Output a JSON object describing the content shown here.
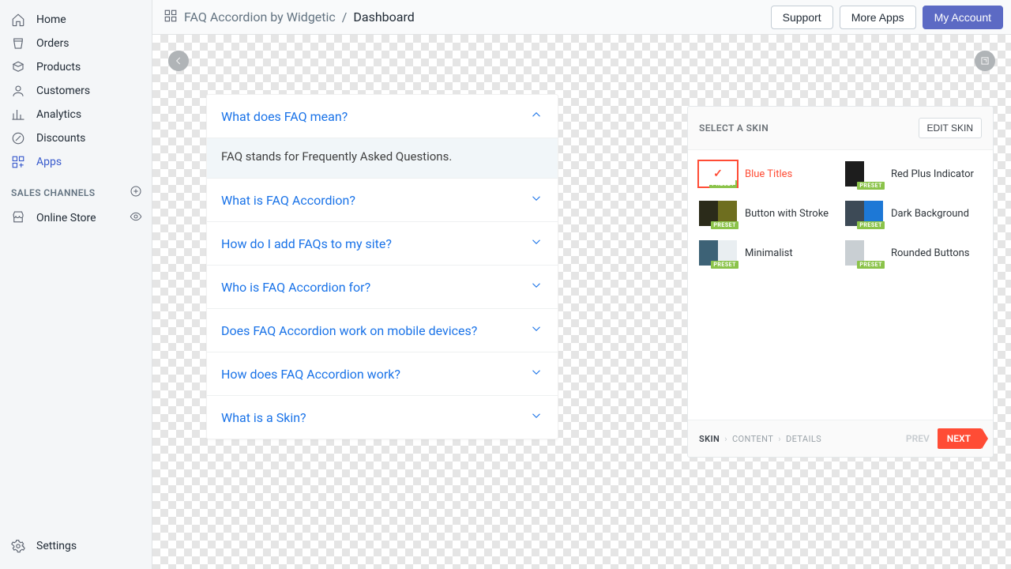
{
  "sidebar": {
    "items": [
      {
        "label": "Home"
      },
      {
        "label": "Orders"
      },
      {
        "label": "Products"
      },
      {
        "label": "Customers"
      },
      {
        "label": "Analytics"
      },
      {
        "label": "Discounts"
      },
      {
        "label": "Apps"
      }
    ],
    "section_label": "SALES CHANNELS",
    "channel_label": "Online Store",
    "settings_label": "Settings"
  },
  "topbar": {
    "app_name": "FAQ Accordion by Widgetic",
    "breadcrumb_current": "Dashboard",
    "support": "Support",
    "more_apps": "More Apps",
    "my_account": "My Account"
  },
  "accordion": {
    "items": [
      {
        "title": "What does FAQ mean?",
        "body": "FAQ stands for Frequently Asked Questions.",
        "open": true
      },
      {
        "title": "What is FAQ Accordion?",
        "open": false
      },
      {
        "title": "How do I add FAQs to my site?",
        "open": false
      },
      {
        "title": "Who is FAQ Accordion for?",
        "open": false
      },
      {
        "title": "Does FAQ Accordion work on mobile devices?",
        "open": false
      },
      {
        "title": "How does FAQ Accordion work?",
        "open": false
      },
      {
        "title": "What is a Skin?",
        "open": false
      }
    ]
  },
  "skin_panel": {
    "title": "SELECT A SKIN",
    "edit": "EDIT SKIN",
    "skins": [
      {
        "name": "Blue Titles",
        "selected": true,
        "c1": "#d9e4ee",
        "c2": "#ffffff"
      },
      {
        "name": "Red Plus Indicator",
        "selected": false,
        "c1": "#1d1d1d",
        "c2": "#ffffff"
      },
      {
        "name": "Button with Stroke",
        "selected": false,
        "c1": "#2b2b1a",
        "c2": "#6e6e1f"
      },
      {
        "name": "Dark Background",
        "selected": false,
        "c1": "#3d4a56",
        "c2": "#1d78d6"
      },
      {
        "name": "Minimalist",
        "selected": false,
        "c1": "#3d6276",
        "c2": "#e9eef1"
      },
      {
        "name": "Rounded Buttons",
        "selected": false,
        "c1": "#c9cfd3",
        "c2": "#ffffff"
      }
    ],
    "preset_tag": "PRESET",
    "steps": [
      "SKIN",
      "CONTENT",
      "DETAILS"
    ],
    "prev": "PREV",
    "next": "NEXT"
  }
}
